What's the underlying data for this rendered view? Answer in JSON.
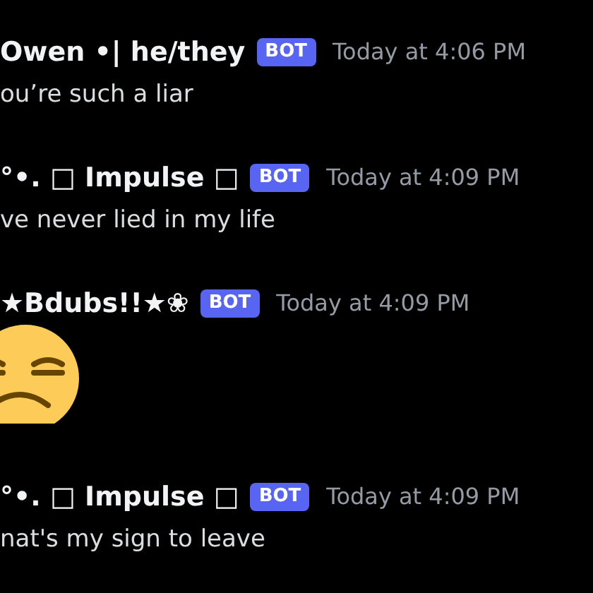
{
  "messages": [
    {
      "author": "Owen •| he/they",
      "badge": "BOT",
      "time": "Today at 4:06 PM",
      "kind": "text",
      "text": "ou’re such a liar"
    },
    {
      "author": "°•. □ Impulse □",
      "badge": "BOT",
      "time": "Today at 4:09 PM",
      "kind": "text",
      "text": "ve never lied in my life"
    },
    {
      "author": "★Bdubs!!★❀",
      "badge": "BOT",
      "time": "Today at 4:09 PM",
      "kind": "emoji"
    },
    {
      "author": "°•. □ Impulse □",
      "badge": "BOT",
      "time": "Today at 4:09 PM",
      "kind": "text",
      "text": "nat's my sign to leave"
    }
  ]
}
